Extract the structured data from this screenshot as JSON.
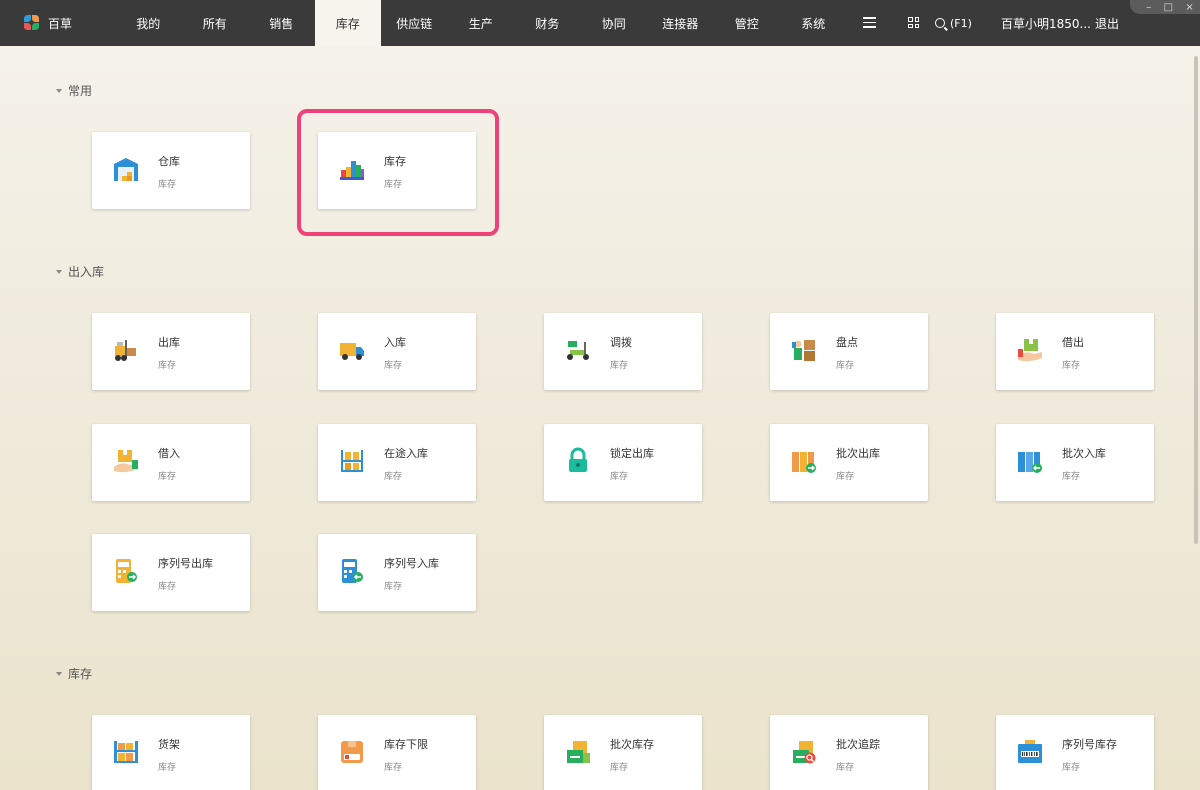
{
  "app": {
    "brand": "百草"
  },
  "nav": {
    "items": [
      "我的",
      "所有",
      "销售",
      "库存",
      "供应链",
      "生产",
      "财务",
      "协同",
      "连接器",
      "管控",
      "系统"
    ],
    "active_index": 3
  },
  "toolbar": {
    "search_shortcut": "(F1)",
    "user": "百草小明1850...",
    "logout": "退出"
  },
  "window_controls": {
    "minimize": "–",
    "maximize": "□",
    "close": "×"
  },
  "sections": [
    {
      "title": "常用",
      "cards": [
        {
          "title": "仓库",
          "sub": "库存",
          "icon": "warehouse-icon"
        },
        {
          "title": "库存",
          "sub": "库存",
          "icon": "stock-blocks-icon",
          "highlighted": true
        }
      ]
    },
    {
      "title": "出入库",
      "cards": [
        {
          "title": "出库",
          "sub": "库存",
          "icon": "forklift-icon"
        },
        {
          "title": "入库",
          "sub": "库存",
          "icon": "delivery-truck-icon"
        },
        {
          "title": "调拨",
          "sub": "库存",
          "icon": "scooter-icon"
        },
        {
          "title": "盘点",
          "sub": "库存",
          "icon": "inventory-count-icon"
        },
        {
          "title": "借出",
          "sub": "库存",
          "icon": "lend-out-icon"
        },
        {
          "title": "借入",
          "sub": "库存",
          "icon": "borrow-in-icon"
        },
        {
          "title": "在途入库",
          "sub": "库存",
          "icon": "shelf-boxes-icon"
        },
        {
          "title": "锁定出库",
          "sub": "库存",
          "icon": "lock-icon"
        },
        {
          "title": "批次出库",
          "sub": "库存",
          "icon": "batch-out-icon"
        },
        {
          "title": "批次入库",
          "sub": "库存",
          "icon": "batch-in-icon"
        },
        {
          "title": "序列号出库",
          "sub": "库存",
          "icon": "serial-out-icon"
        },
        {
          "title": "序列号入库",
          "sub": "库存",
          "icon": "serial-in-icon"
        }
      ]
    },
    {
      "title": "库存",
      "cards": [
        {
          "title": "货架",
          "sub": "库存",
          "icon": "rack-icon"
        },
        {
          "title": "库存下限",
          "sub": "库存",
          "icon": "stock-min-icon"
        },
        {
          "title": "批次库存",
          "sub": "库存",
          "icon": "batch-stock-icon"
        },
        {
          "title": "批次追踪",
          "sub": "库存",
          "icon": "batch-trace-icon"
        },
        {
          "title": "序列号库存",
          "sub": "库存",
          "icon": "serial-stock-icon"
        }
      ]
    }
  ]
}
